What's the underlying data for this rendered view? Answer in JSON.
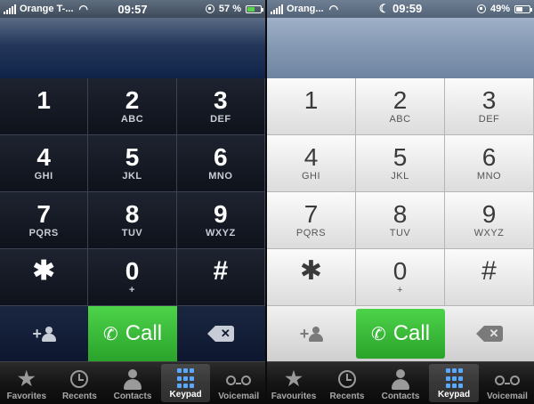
{
  "screens": [
    {
      "theme": "dark",
      "status": {
        "carrier": "Orange T-...",
        "time": "09:57",
        "battery": "57 %",
        "battery_level": 0.57,
        "wifi_icon": "wifi-icon",
        "lock_icon": "rotation-lock-icon"
      },
      "keys": [
        {
          "digit": "1",
          "letters": ""
        },
        {
          "digit": "2",
          "letters": "ABC"
        },
        {
          "digit": "3",
          "letters": "DEF"
        },
        {
          "digit": "4",
          "letters": "GHI"
        },
        {
          "digit": "5",
          "letters": "JKL"
        },
        {
          "digit": "6",
          "letters": "MNO"
        },
        {
          "digit": "7",
          "letters": "PQRS"
        },
        {
          "digit": "8",
          "letters": "TUV"
        },
        {
          "digit": "9",
          "letters": "WXYZ"
        },
        {
          "digit": "✱",
          "letters": ""
        },
        {
          "digit": "0",
          "letters": "+"
        },
        {
          "digit": "#",
          "letters": ""
        }
      ],
      "actions": {
        "add_contact_plus": "+",
        "call_label": "Call",
        "call_color": "#35b535"
      },
      "tabs": [
        {
          "label": "Favorites",
          "icon": "star-icon",
          "active": false
        },
        {
          "label": "Recents",
          "icon": "clock-icon",
          "active": false
        },
        {
          "label": "Contacts",
          "icon": "contact-icon",
          "active": false
        },
        {
          "label": "Keypad",
          "icon": "keypad-icon",
          "active": true
        },
        {
          "label": "Voicemail",
          "icon": "voicemail-icon",
          "active": false
        }
      ]
    },
    {
      "theme": "light",
      "status": {
        "carrier": "Orang...",
        "time": "09:59",
        "battery": "49%",
        "battery_level": 0.49,
        "wifi_icon": "wifi-icon",
        "moon_icon": "moon-icon",
        "lock_icon": "rotation-lock-icon"
      },
      "keys": [
        {
          "digit": "1",
          "letters": ""
        },
        {
          "digit": "2",
          "letters": "ABC"
        },
        {
          "digit": "3",
          "letters": "DEF"
        },
        {
          "digit": "4",
          "letters": "GHI"
        },
        {
          "digit": "5",
          "letters": "JKL"
        },
        {
          "digit": "6",
          "letters": "MNO"
        },
        {
          "digit": "7",
          "letters": "PQRS"
        },
        {
          "digit": "8",
          "letters": "TUV"
        },
        {
          "digit": "9",
          "letters": "WXYZ"
        },
        {
          "digit": "✱",
          "letters": ""
        },
        {
          "digit": "0",
          "letters": "+"
        },
        {
          "digit": "#",
          "letters": ""
        }
      ],
      "actions": {
        "add_contact_plus": "+",
        "call_label": "Call",
        "call_color": "#35b535"
      },
      "tabs": [
        {
          "label": "Favourites",
          "icon": "star-icon",
          "active": false
        },
        {
          "label": "Recents",
          "icon": "clock-icon",
          "active": false
        },
        {
          "label": "Contacts",
          "icon": "contact-icon",
          "active": false
        },
        {
          "label": "Keypad",
          "icon": "keypad-icon",
          "active": true
        },
        {
          "label": "Voicemail",
          "icon": "voicemail-icon",
          "active": false
        }
      ]
    }
  ]
}
